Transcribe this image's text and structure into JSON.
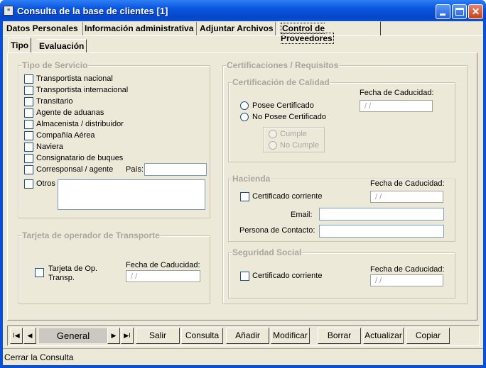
{
  "window": {
    "title": "Consulta de la base de clientes [1]",
    "icon": "app-icon"
  },
  "main_tabs": [
    {
      "label": "Datos Personales",
      "active": false
    },
    {
      "label": "Información administrativa",
      "active": false
    },
    {
      "label": "Adjuntar Archivos",
      "active": false
    },
    {
      "label": "Control de Proveedores",
      "active": true
    }
  ],
  "sub_tabs": [
    {
      "label": "Tipo",
      "active": true
    },
    {
      "label": "Evaluación",
      "active": false
    }
  ],
  "tipo_servicio": {
    "title": "Tipo de Servicio",
    "options": [
      "Transportista nacional",
      "Transportista internacional",
      "Transitario",
      "Agente de aduanas",
      "Almacenista / distribuidor",
      "Compañía Aérea",
      "Naviera",
      "Consignatario de buques",
      "Corresponsal / agente",
      "Otros"
    ],
    "pais_label": "País:",
    "pais_value": "",
    "otros_value": ""
  },
  "tarjeta": {
    "title": "Tarjeta de operador de Transporte",
    "checkbox_label_1": "Tarjeta de Op.",
    "checkbox_label_2": "Transp.",
    "fecha_label": "Fecha de Caducidad:",
    "fecha_value": "/ /"
  },
  "certificaciones": {
    "title": "Certificaciones / Requisitos",
    "calidad": {
      "title": "Certificación de Calidad",
      "radio_posee": "Posee Certificado",
      "radio_no_posee": "No Posee Certificado",
      "radio_cumple": "Cumple",
      "radio_no_cumple": "No Cumple",
      "fecha_label": "Fecha de Caducidad:",
      "fecha_value": "/ /"
    }
  },
  "hacienda": {
    "title": "Hacienda",
    "checkbox_label": "Certificado corriente",
    "fecha_label": "Fecha de Caducidad:",
    "fecha_value": "/ /",
    "email_label": "Email:",
    "email_value": "",
    "contacto_label": "Persona de Contacto:",
    "contacto_value": ""
  },
  "seguridad_social": {
    "title": "Seguridad Social",
    "checkbox_label": "Certificado corriente",
    "fecha_label": "Fecha de Caducidad:",
    "fecha_value": "/ /"
  },
  "navigator": {
    "label": "General",
    "first": "I◀",
    "prev": "◀",
    "next": "▶",
    "last": "▶I"
  },
  "buttons": {
    "salir": "Salir",
    "consulta": "Consulta",
    "anadir": "Añadir",
    "modificar": "Modificar",
    "borrar": "Borrar",
    "actualizar": "Actualizar",
    "copiar": "Copiar"
  },
  "status": "Cerrar la Consulta"
}
